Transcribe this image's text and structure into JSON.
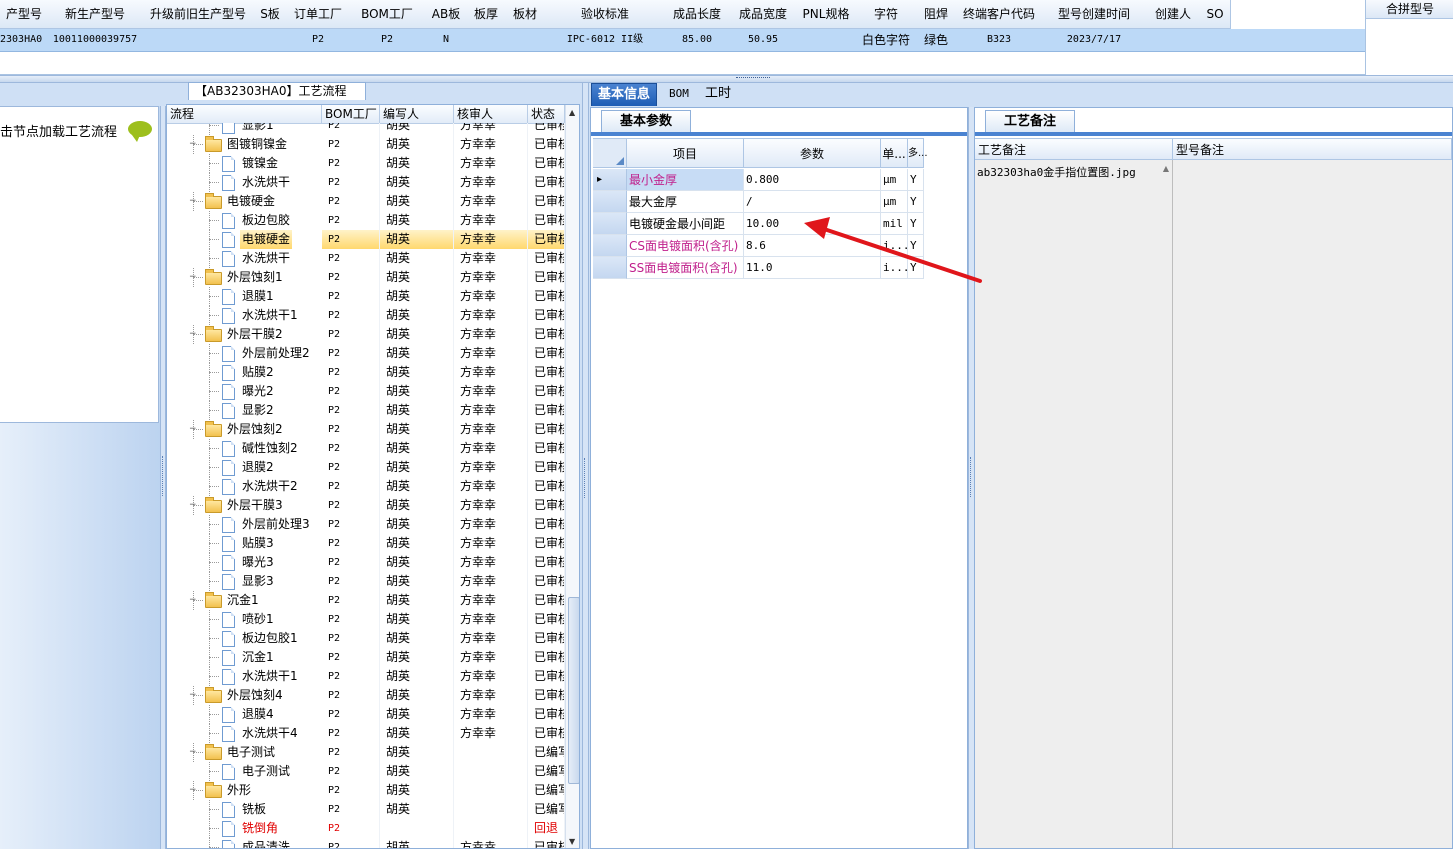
{
  "top_grid": {
    "headers": [
      "产型号",
      "新生产型号",
      "升级前旧生产型号",
      "S板",
      "订单工厂",
      "BOM工厂",
      "AB板",
      "板厚",
      "板材",
      "验收标准",
      "成品长度",
      "成品宽度",
      "PNL规格",
      "字符",
      "阻焊",
      "终端客户代码",
      "型号创建时间",
      "创建人",
      "SO"
    ],
    "row": [
      "2303HA0",
      "10011000039757",
      "",
      "",
      "P2",
      "P2",
      "N",
      "",
      "",
      "IPC-6012 II级",
      "85.00",
      "50.95",
      "",
      "白色字符",
      "绿色",
      "B323",
      "2023/7/17",
      "",
      ""
    ],
    "merge_header": "合拼型号"
  },
  "left_panel": {
    "hint": "击节点加载工艺流程"
  },
  "process_tree": {
    "title": "【AB32303HA0】工艺流程",
    "columns": [
      "流程",
      "BOM工厂",
      "编写人",
      "核审人",
      "状态"
    ],
    "rows": [
      {
        "name": "显影1",
        "type": "doc",
        "bom": "P2",
        "writer": "胡英",
        "reviewer": "方幸幸",
        "status": "已审核",
        "selected": false,
        "red": false
      },
      {
        "name": "图镀铜镍金",
        "type": "folder",
        "bom": "P2",
        "writer": "胡英",
        "reviewer": "方幸幸",
        "status": "已审核",
        "selected": false,
        "red": false
      },
      {
        "name": "镀镍金",
        "type": "doc",
        "bom": "P2",
        "writer": "胡英",
        "reviewer": "方幸幸",
        "status": "已审核",
        "selected": false,
        "red": false
      },
      {
        "name": "水洗烘干",
        "type": "doc",
        "bom": "P2",
        "writer": "胡英",
        "reviewer": "方幸幸",
        "status": "已审核",
        "selected": false,
        "red": false
      },
      {
        "name": "电镀硬金",
        "type": "folder",
        "bom": "P2",
        "writer": "胡英",
        "reviewer": "方幸幸",
        "status": "已审核",
        "selected": false,
        "red": false
      },
      {
        "name": "板边包胶",
        "type": "doc",
        "bom": "P2",
        "writer": "胡英",
        "reviewer": "方幸幸",
        "status": "已审核",
        "selected": false,
        "red": false
      },
      {
        "name": "电镀硬金",
        "type": "doc",
        "bom": "P2",
        "writer": "胡英",
        "reviewer": "方幸幸",
        "status": "已审核",
        "selected": true,
        "red": false
      },
      {
        "name": "水洗烘干",
        "type": "doc",
        "bom": "P2",
        "writer": "胡英",
        "reviewer": "方幸幸",
        "status": "已审核",
        "selected": false,
        "red": false
      },
      {
        "name": "外层蚀刻1",
        "type": "folder",
        "bom": "P2",
        "writer": "胡英",
        "reviewer": "方幸幸",
        "status": "已审核",
        "selected": false,
        "red": false
      },
      {
        "name": "退膜1",
        "type": "doc",
        "bom": "P2",
        "writer": "胡英",
        "reviewer": "方幸幸",
        "status": "已审核",
        "selected": false,
        "red": false
      },
      {
        "name": "水洗烘干1",
        "type": "doc",
        "bom": "P2",
        "writer": "胡英",
        "reviewer": "方幸幸",
        "status": "已审核",
        "selected": false,
        "red": false
      },
      {
        "name": "外层干膜2",
        "type": "folder",
        "bom": "P2",
        "writer": "胡英",
        "reviewer": "方幸幸",
        "status": "已审核",
        "selected": false,
        "red": false
      },
      {
        "name": "外层前处理2",
        "type": "doc",
        "bom": "P2",
        "writer": "胡英",
        "reviewer": "方幸幸",
        "status": "已审核",
        "selected": false,
        "red": false
      },
      {
        "name": "贴膜2",
        "type": "doc",
        "bom": "P2",
        "writer": "胡英",
        "reviewer": "方幸幸",
        "status": "已审核",
        "selected": false,
        "red": false
      },
      {
        "name": "曝光2",
        "type": "doc",
        "bom": "P2",
        "writer": "胡英",
        "reviewer": "方幸幸",
        "status": "已审核",
        "selected": false,
        "red": false
      },
      {
        "name": "显影2",
        "type": "doc",
        "bom": "P2",
        "writer": "胡英",
        "reviewer": "方幸幸",
        "status": "已审核",
        "selected": false,
        "red": false
      },
      {
        "name": "外层蚀刻2",
        "type": "folder",
        "bom": "P2",
        "writer": "胡英",
        "reviewer": "方幸幸",
        "status": "已审核",
        "selected": false,
        "red": false
      },
      {
        "name": "碱性蚀刻2",
        "type": "doc",
        "bom": "P2",
        "writer": "胡英",
        "reviewer": "方幸幸",
        "status": "已审核",
        "selected": false,
        "red": false
      },
      {
        "name": "退膜2",
        "type": "doc",
        "bom": "P2",
        "writer": "胡英",
        "reviewer": "方幸幸",
        "status": "已审核",
        "selected": false,
        "red": false
      },
      {
        "name": "水洗烘干2",
        "type": "doc",
        "bom": "P2",
        "writer": "胡英",
        "reviewer": "方幸幸",
        "status": "已审核",
        "selected": false,
        "red": false
      },
      {
        "name": "外层干膜3",
        "type": "folder",
        "bom": "P2",
        "writer": "胡英",
        "reviewer": "方幸幸",
        "status": "已审核",
        "selected": false,
        "red": false
      },
      {
        "name": "外层前处理3",
        "type": "doc",
        "bom": "P2",
        "writer": "胡英",
        "reviewer": "方幸幸",
        "status": "已审核",
        "selected": false,
        "red": false
      },
      {
        "name": "贴膜3",
        "type": "doc",
        "bom": "P2",
        "writer": "胡英",
        "reviewer": "方幸幸",
        "status": "已审核",
        "selected": false,
        "red": false
      },
      {
        "name": "曝光3",
        "type": "doc",
        "bom": "P2",
        "writer": "胡英",
        "reviewer": "方幸幸",
        "status": "已审核",
        "selected": false,
        "red": false
      },
      {
        "name": "显影3",
        "type": "doc",
        "bom": "P2",
        "writer": "胡英",
        "reviewer": "方幸幸",
        "status": "已审核",
        "selected": false,
        "red": false
      },
      {
        "name": "沉金1",
        "type": "folder",
        "bom": "P2",
        "writer": "胡英",
        "reviewer": "方幸幸",
        "status": "已审核",
        "selected": false,
        "red": false
      },
      {
        "name": "喷砂1",
        "type": "doc",
        "bom": "P2",
        "writer": "胡英",
        "reviewer": "方幸幸",
        "status": "已审核",
        "selected": false,
        "red": false
      },
      {
        "name": "板边包胶1",
        "type": "doc",
        "bom": "P2",
        "writer": "胡英",
        "reviewer": "方幸幸",
        "status": "已审核",
        "selected": false,
        "red": false
      },
      {
        "name": "沉金1",
        "type": "doc",
        "bom": "P2",
        "writer": "胡英",
        "reviewer": "方幸幸",
        "status": "已审核",
        "selected": false,
        "red": false
      },
      {
        "name": "水洗烘干1",
        "type": "doc",
        "bom": "P2",
        "writer": "胡英",
        "reviewer": "方幸幸",
        "status": "已审核",
        "selected": false,
        "red": false
      },
      {
        "name": "外层蚀刻4",
        "type": "folder",
        "bom": "P2",
        "writer": "胡英",
        "reviewer": "方幸幸",
        "status": "已审核",
        "selected": false,
        "red": false
      },
      {
        "name": "退膜4",
        "type": "doc",
        "bom": "P2",
        "writer": "胡英",
        "reviewer": "方幸幸",
        "status": "已审核",
        "selected": false,
        "red": false
      },
      {
        "name": "水洗烘干4",
        "type": "doc",
        "bom": "P2",
        "writer": "胡英",
        "reviewer": "方幸幸",
        "status": "已审核",
        "selected": false,
        "red": false
      },
      {
        "name": "电子测试",
        "type": "folder",
        "bom": "P2",
        "writer": "胡英",
        "reviewer": "",
        "status": "已编写",
        "selected": false,
        "red": false
      },
      {
        "name": "电子测试",
        "type": "doc",
        "bom": "P2",
        "writer": "胡英",
        "reviewer": "",
        "status": "已编写",
        "selected": false,
        "red": false
      },
      {
        "name": "外形",
        "type": "folder",
        "bom": "P2",
        "writer": "胡英",
        "reviewer": "",
        "status": "已编写",
        "selected": false,
        "red": false
      },
      {
        "name": "铣板",
        "type": "doc",
        "bom": "P2",
        "writer": "胡英",
        "reviewer": "",
        "status": "已编写",
        "selected": false,
        "red": false
      },
      {
        "name": "铣倒角",
        "type": "doc",
        "bom": "P2",
        "writer": "",
        "reviewer": "",
        "status": "回退",
        "selected": false,
        "red": true
      },
      {
        "name": "成品清洗",
        "type": "doc",
        "bom": "P2",
        "writer": "胡英",
        "reviewer": "方幸幸",
        "status": "已审核",
        "selected": false,
        "red": false
      }
    ]
  },
  "tabs": [
    "基本信息",
    "BOM",
    "工时"
  ],
  "basic_params": {
    "tab_label": "基本参数",
    "columns": [
      "项目",
      "参数",
      "单...",
      "多..."
    ],
    "rows": [
      {
        "item": "最小金厚",
        "value": "0.800",
        "unit": "μm",
        "flag": "Y",
        "pink": true
      },
      {
        "item": "最大金厚",
        "value": "/",
        "unit": "μm",
        "flag": "Y",
        "pink": false
      },
      {
        "item": "电镀硬金最小间距",
        "value": "10.00",
        "unit": "mil",
        "flag": "Y",
        "pink": false
      },
      {
        "item": "CS面电镀面积(含孔)",
        "value": "8.6",
        "unit": "i...",
        "flag": "Y",
        "pink": true
      },
      {
        "item": "SS面电镀面积(含孔)",
        "value": "11.0",
        "unit": "i...",
        "flag": "Y",
        "pink": true
      }
    ]
  },
  "process_notes": {
    "tab_label": "工艺备注",
    "col1": "工艺备注",
    "col2": "型号备注",
    "note_text": "ab32303ha0金手指位置图.jpg"
  },
  "colors": {
    "annotation_arrow": "#e0161b",
    "selected_row": "#ffd86e",
    "pink_text": "#c0208c",
    "red_text": "#e00000",
    "tab_active": "#1e5db5"
  }
}
